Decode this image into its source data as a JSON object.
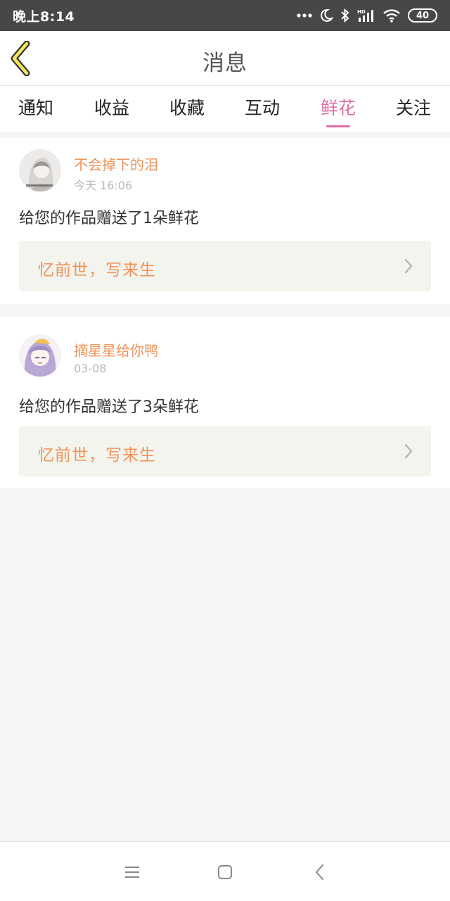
{
  "status_bar": {
    "time": "晚上8:14",
    "battery": "40",
    "icons": [
      "more-dots-icon",
      "moon-icon",
      "bluetooth-icon",
      "hd-signal-icon",
      "wifi-icon",
      "battery-icon"
    ]
  },
  "header": {
    "title": "消息",
    "back_icon": "chevron-left-icon"
  },
  "tabs": [
    {
      "label": "通知",
      "active": false
    },
    {
      "label": "收益",
      "active": false
    },
    {
      "label": "收藏",
      "active": false
    },
    {
      "label": "互动",
      "active": false
    },
    {
      "label": "鲜花",
      "active": true
    },
    {
      "label": "关注",
      "active": false
    }
  ],
  "messages": [
    {
      "sender": "不会掉下的泪",
      "time": "今天 16:06",
      "text": "给您的作品赠送了1朵鲜花",
      "work_title": "忆前世，写来生"
    },
    {
      "sender": "摘星星给你鸭",
      "time": "03-08",
      "text": "给您的作品赠送了3朵鲜花",
      "work_title": "忆前世，写来生"
    }
  ],
  "colors": {
    "accent_pink": "#e06fa5",
    "accent_orange": "#f0935a",
    "status_bar_bg": "#474747"
  },
  "nav_bar": {
    "icons": [
      "menu-icon",
      "home-square-icon",
      "back-triangle-icon"
    ]
  }
}
